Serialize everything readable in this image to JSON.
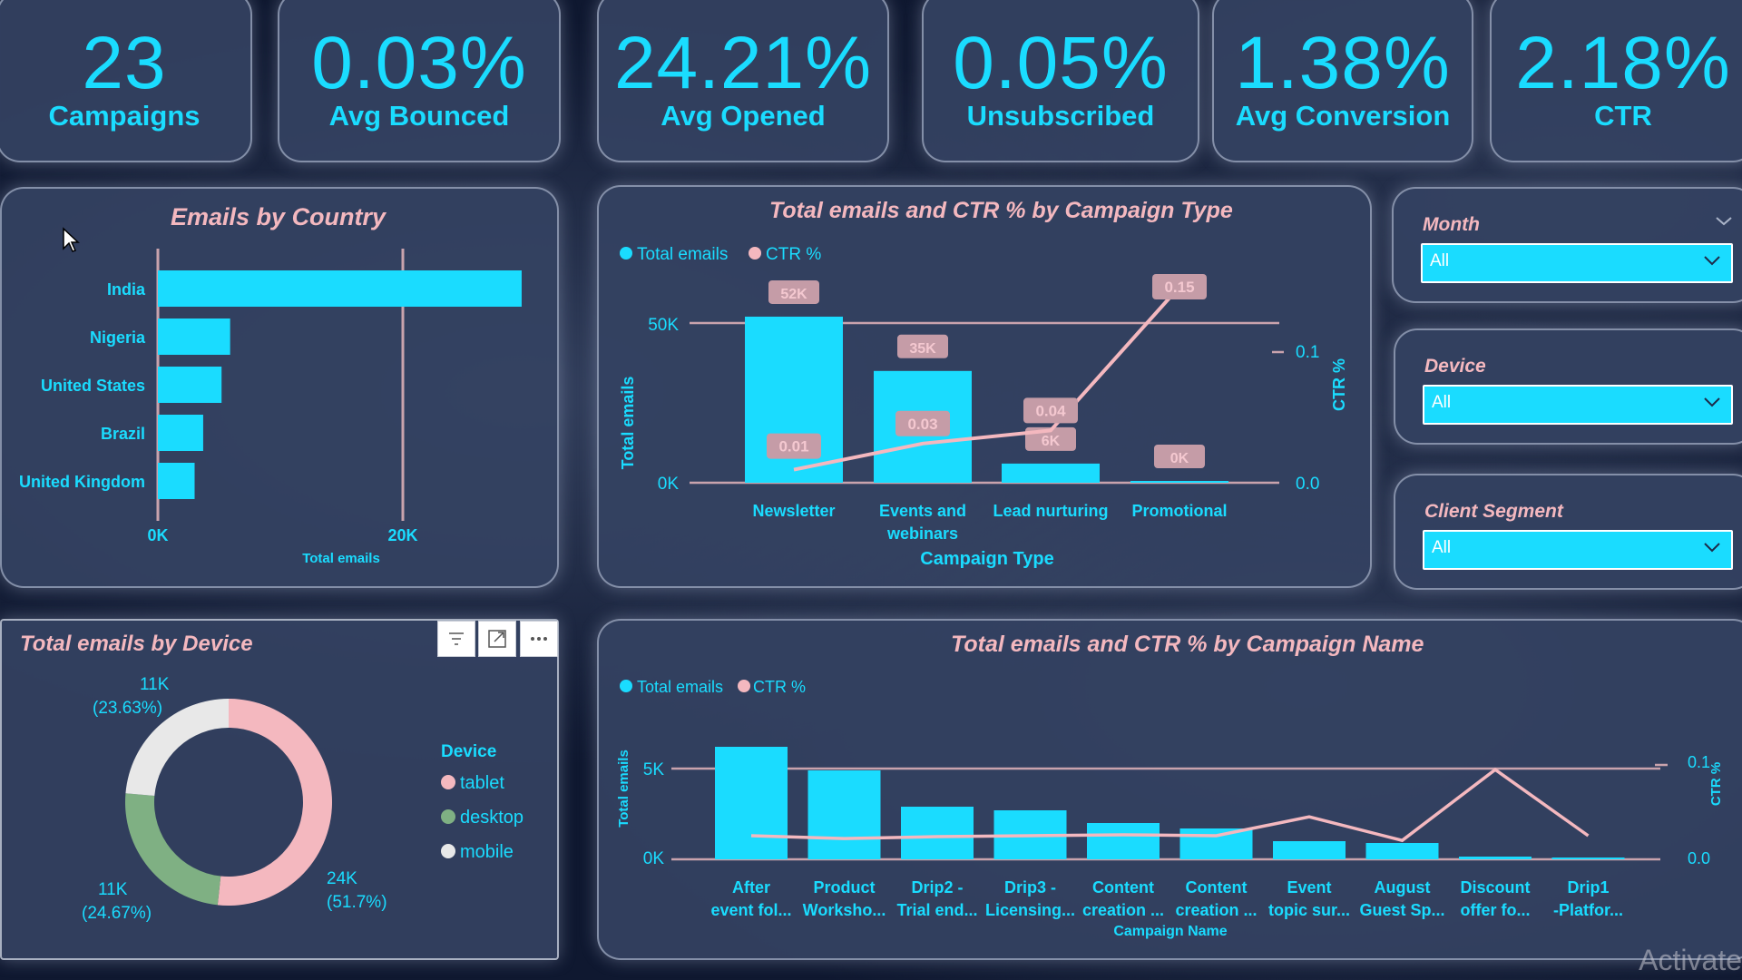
{
  "kpis": [
    {
      "value": "23",
      "label": "Campaigns"
    },
    {
      "value": "0.03%",
      "label": "Avg Bounced"
    },
    {
      "value": "24.21%",
      "label": "Avg Opened"
    },
    {
      "value": "0.05%",
      "label": "Unsubscribed"
    },
    {
      "value": "1.38%",
      "label": "Avg Conversion"
    },
    {
      "value": "2.18%",
      "label": "CTR"
    }
  ],
  "country_chart": {
    "title": "Emails by Country",
    "xlabel": "Total emails",
    "tick_labels": [
      "0K",
      "20K"
    ]
  },
  "campaign_type_chart": {
    "title": "Total emails and CTR % by Campaign Type",
    "legend": [
      "Total emails",
      "CTR %"
    ],
    "ylabel": "Total emails",
    "y2label": "CTR %",
    "xlabel": "Campaign Type",
    "y_ticks": [
      "0K",
      "50K"
    ],
    "y2_ticks": [
      "0.0",
      "0.1"
    ],
    "categories": [
      "Newsletter",
      "Events and",
      "webinars",
      "Lead nurturing",
      "Promotional"
    ],
    "bar_labels": [
      "52K",
      "35K",
      "6K",
      "0K"
    ],
    "line_labels": [
      "0.01",
      "0.03",
      "0.04",
      "0.15"
    ]
  },
  "device_chart": {
    "title": "Total emails by Device",
    "legend_title": "Device",
    "legend": [
      "tablet",
      "desktop",
      "mobile"
    ],
    "labels": [
      {
        "value": "24K",
        "pct": "(51.7%)"
      },
      {
        "value": "11K",
        "pct": "(24.67%)"
      },
      {
        "value": "11K",
        "pct": "(23.63%)"
      }
    ]
  },
  "campaign_name_chart": {
    "title": "Total emails and CTR % by Campaign Name",
    "legend": [
      "Total emails",
      "CTR %"
    ],
    "ylabel": "Total emails",
    "y2label": "CTR %",
    "xlabel": "Campaign Name",
    "y_ticks": [
      "0K",
      "5K"
    ],
    "y2_ticks": [
      "0.0",
      "0.1"
    ],
    "categories_line1": [
      "After",
      "Product",
      "Drip2 -",
      "Drip3 -",
      "Content",
      "Content",
      "Event",
      "August",
      "Discount",
      "Drip1"
    ],
    "categories_line2": [
      "event fol...",
      "Worksho...",
      "Trial end...",
      "Licensing...",
      "creation ...",
      "creation ...",
      "topic sur...",
      "Guest Sp...",
      "offer fo...",
      "-Platfor..."
    ]
  },
  "slicers": [
    {
      "title": "Month",
      "value": "All"
    },
    {
      "title": "Device",
      "value": "All"
    },
    {
      "title": "Client Segment",
      "value": "All"
    }
  ],
  "watermark": "Activate",
  "colors": {
    "primary": "#1adcff",
    "secondary": "#f4b8bf",
    "desktop": "#7fb083",
    "mobile": "#e8e8e8"
  },
  "chart_data": [
    {
      "type": "bar",
      "title": "Emails by Country",
      "categories": [
        "India",
        "Nigeria",
        "United States",
        "Brazil",
        "United Kingdom"
      ],
      "values": [
        29700,
        5900,
        5200,
        3700,
        3000
      ],
      "xlabel": "Total emails",
      "xlim": [
        0,
        30000
      ]
    },
    {
      "type": "bar",
      "title": "Total emails and CTR % by Campaign Type",
      "categories": [
        "Newsletter",
        "Events and webinars",
        "Lead nurturing",
        "Promotional"
      ],
      "series": [
        {
          "name": "Total emails",
          "values": [
            52000,
            35000,
            6000,
            400
          ]
        },
        {
          "name": "CTR %",
          "values": [
            0.01,
            0.03,
            0.04,
            0.15
          ]
        }
      ],
      "xlabel": "Campaign Type",
      "ylabel": "Total emails",
      "ylim": [
        0,
        60000
      ],
      "y2lim": [
        0,
        0.17
      ]
    },
    {
      "type": "pie",
      "title": "Total emails by Device",
      "categories": [
        "tablet",
        "desktop",
        "mobile"
      ],
      "values": [
        24000,
        11000,
        11000
      ],
      "percent": [
        51.7,
        24.67,
        23.63
      ]
    },
    {
      "type": "bar",
      "title": "Total emails and CTR % by Campaign Name",
      "categories": [
        "After event fol...",
        "Product Worksho...",
        "Drip2 - Trial end...",
        "Drip3 - Licensing...",
        "Content creation ...",
        "Content creation ...",
        "Event topic sur...",
        "August Guest Sp...",
        "Discount offer fo...",
        "Drip1 -Platfor..."
      ],
      "series": [
        {
          "name": "Total emails",
          "values": [
            6200,
            4900,
            2900,
            2700,
            2000,
            1700,
            1000,
            900,
            150,
            100
          ]
        },
        {
          "name": "CTR %",
          "values": [
            0.025,
            0.022,
            0.024,
            0.025,
            0.026,
            0.025,
            0.045,
            0.02,
            0.095,
            0.025
          ]
        }
      ],
      "xlabel": "Campaign Name",
      "ylabel": "Total emails",
      "ylim": [
        0,
        7000
      ],
      "y2lim": [
        0,
        0.12
      ]
    }
  ]
}
